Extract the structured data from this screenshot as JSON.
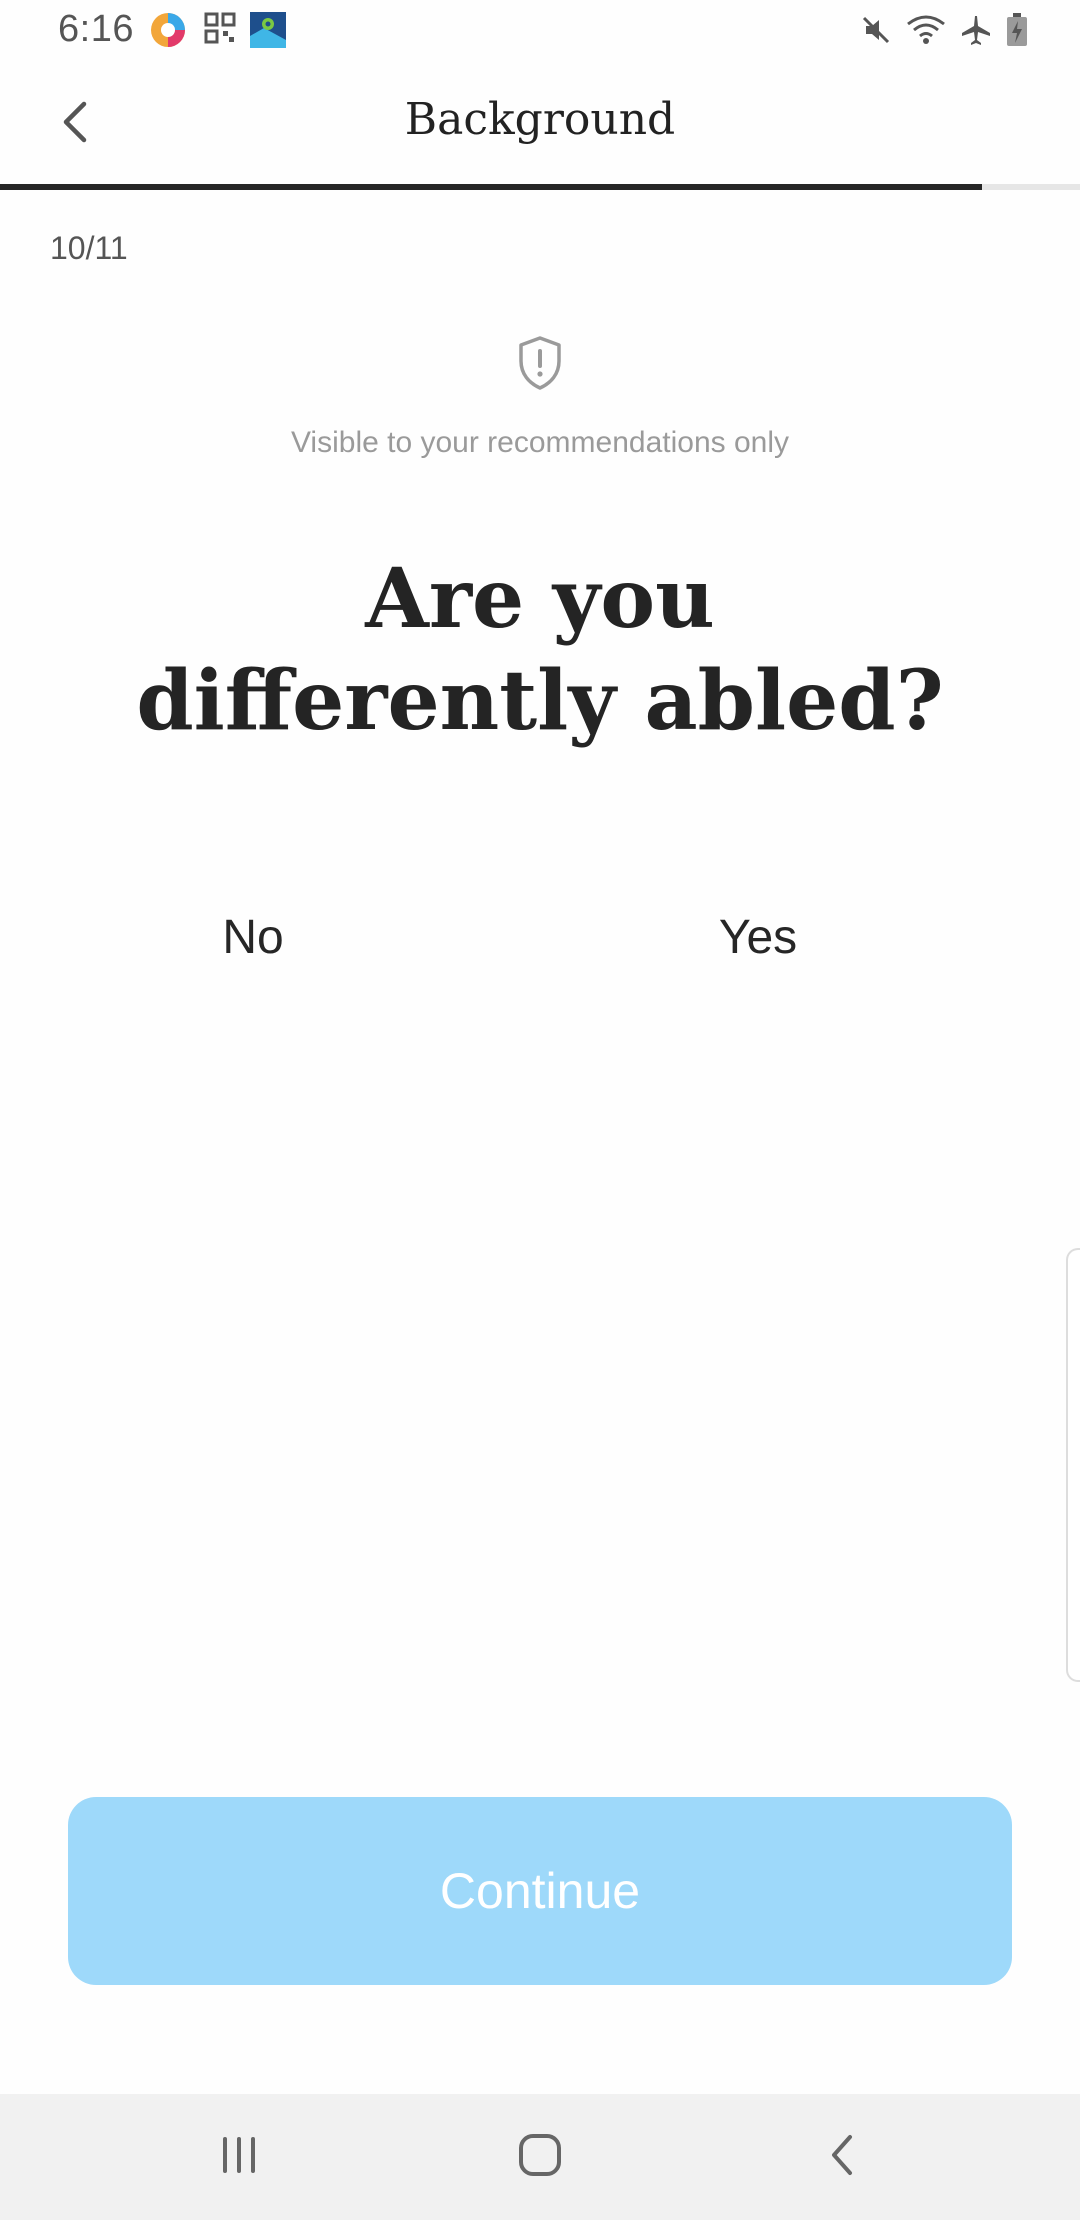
{
  "status_bar": {
    "time": "6:16",
    "icons": [
      "circle-app-icon",
      "qr-icon",
      "maps-icon",
      "mute-icon",
      "wifi-icon",
      "airplane-icon",
      "battery-icon"
    ]
  },
  "header": {
    "title": "Background",
    "back_icon": "chevron-left-icon",
    "progress": 0.909
  },
  "step": {
    "counter": "10/11"
  },
  "privacy": {
    "icon": "shield-alert-icon",
    "note": "Visible to your recommendations only"
  },
  "question": {
    "text": "Are you differently abled?"
  },
  "options": [
    {
      "label": "No"
    },
    {
      "label": "Yes"
    }
  ],
  "actions": {
    "continue_label": "Continue"
  },
  "colors": {
    "continue_button": "#9ed9fa",
    "progress_fill": "#262626",
    "progress_track": "#e6e6e6"
  },
  "nav_bar": {
    "icons": [
      "recent-apps-icon",
      "home-icon",
      "back-icon"
    ]
  }
}
